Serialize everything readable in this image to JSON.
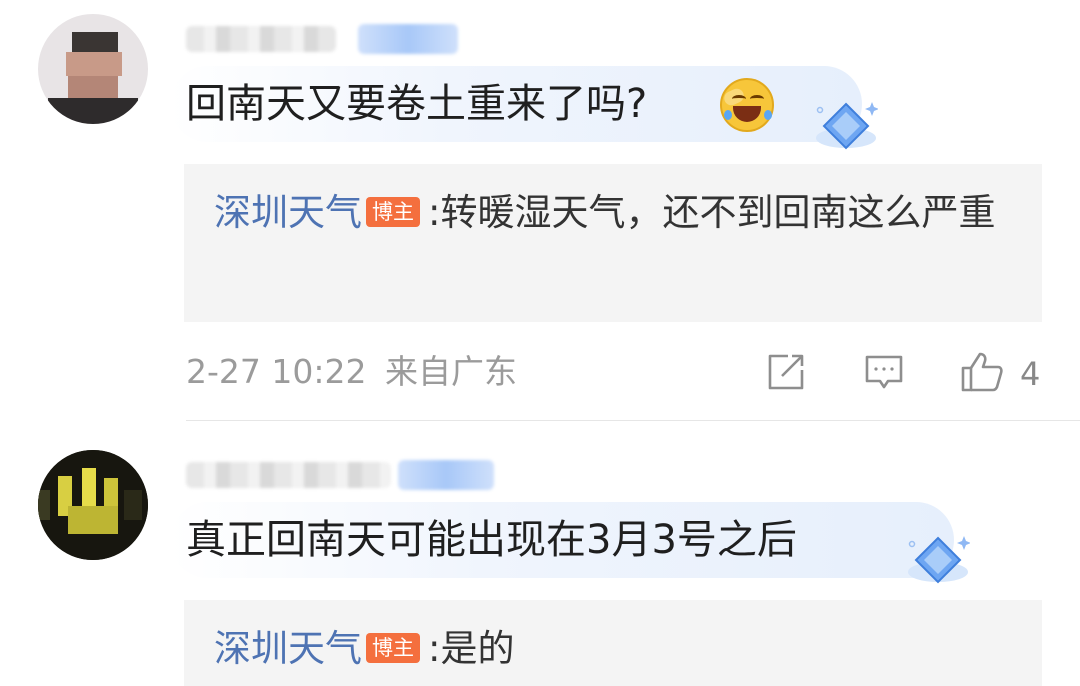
{
  "comments": [
    {
      "text": "回南天又要卷土重来了吗?",
      "reply": {
        "author": "深圳天气",
        "tag": "博主",
        "separator": ":",
        "text": "转暖湿天气，还不到回南这么严重"
      },
      "time": "2-27 10:22",
      "location": "来自广东",
      "likes": "4"
    },
    {
      "text": "真正回南天可能出现在3月3号之后",
      "reply": {
        "author": "深圳天气",
        "tag": "博主",
        "separator": ":",
        "text": "是的"
      }
    }
  ],
  "icons": {
    "emoji": "laugh-cry-emoji-icon",
    "vip_badge": "blue-diamond-badge-icon",
    "share": "share-icon",
    "reply": "comment-icon",
    "like": "thumbs-up-icon"
  },
  "colors": {
    "author_link": "#4e73b3",
    "blogger_tag": "#f46f3e",
    "reply_bg": "#f4f4f4",
    "meta_text": "#9b9b9b"
  }
}
